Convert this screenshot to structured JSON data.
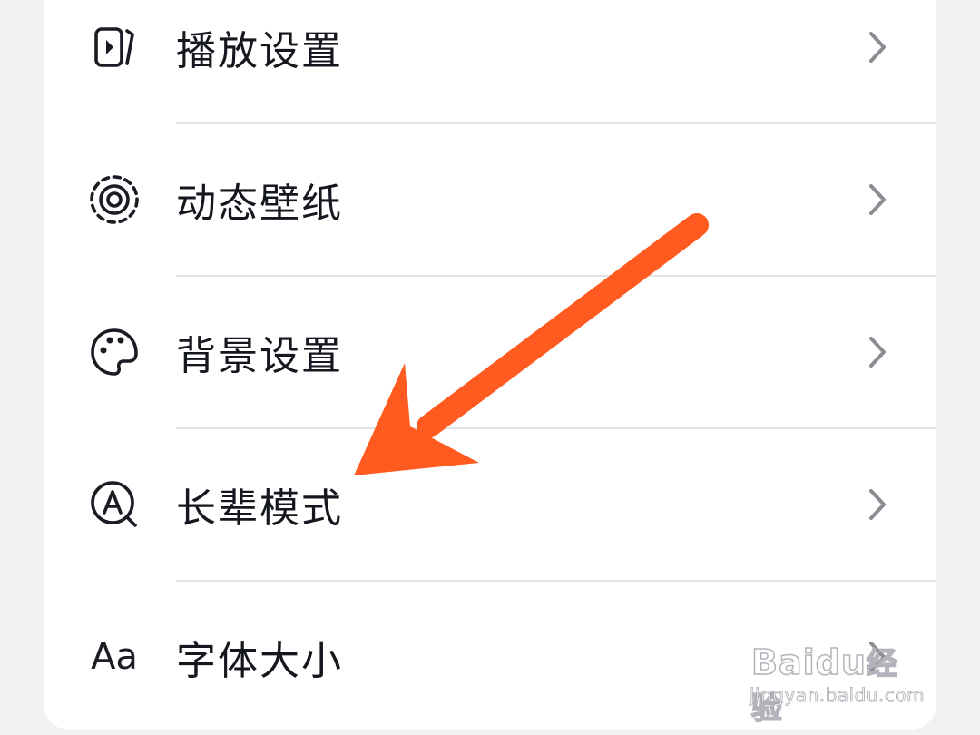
{
  "settings": {
    "items": [
      {
        "label": "播放设置",
        "icon": "play-settings-icon"
      },
      {
        "label": "动态壁纸",
        "icon": "live-wallpaper-icon"
      },
      {
        "label": "背景设置",
        "icon": "palette-icon"
      },
      {
        "label": "长辈模式",
        "icon": "elder-mode-icon"
      },
      {
        "label": "字体大小",
        "icon": "font-size-icon",
        "icon_text": "Aa"
      }
    ]
  },
  "annotation": {
    "arrow_color": "#ff5a1f",
    "target_item": "长辈模式"
  },
  "watermark": {
    "brand": "Bai",
    "brand_mid": "du",
    "brand_cn": "经验",
    "url": "jingyan.baidu.com"
  },
  "colors": {
    "background": "#f2f2f4",
    "card": "#ffffff",
    "text": "#15171e",
    "chevron": "#8a8c93",
    "divider": "#e3e3e6"
  }
}
